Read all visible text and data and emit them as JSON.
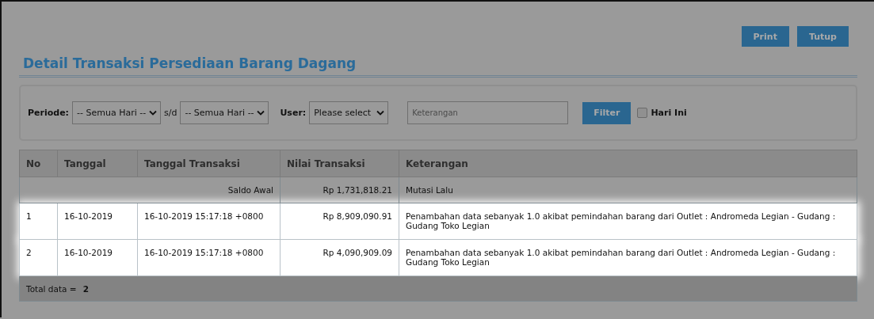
{
  "buttons": [
    {
      "label": "Print"
    },
    {
      "label": "Tutup"
    }
  ],
  "title": "Detail Transaksi Persediaan Barang Dagang",
  "filter": {
    "periode_label": "Periode:",
    "from_value": "-- Semua Hari --",
    "separator": "s/d",
    "to_value": "-- Semua Hari --",
    "user_label": "User:",
    "user_value": "Please select",
    "keterangan_placeholder": "Keterangan",
    "filter_button": "Filter",
    "today_checkbox": {
      "label": "Hari Ini",
      "checked": false
    }
  },
  "table": {
    "columns": [
      "No",
      "Tanggal",
      "Tanggal Transaksi",
      "Nilai Transaksi",
      "Keterangan"
    ],
    "opening": {
      "label": "Saldo Awal",
      "value": "Rp 1,731,818.21",
      "note": "Mutasi Lalu",
      "highlighted": false
    },
    "rows": [
      {
        "no": "1",
        "tanggal": "16-10-2019",
        "tanggal_transaksi": "16-10-2019 15:17:18 +0800",
        "nilai": "Rp 8,909,090.91",
        "keterangan": "Penambahan data sebanyak 1.0 akibat pemindahan barang dari Outlet : Andromeda Legian - Gudang : Gudang Toko Legian",
        "highlighted": true
      },
      {
        "no": "2",
        "tanggal": "16-10-2019",
        "tanggal_transaksi": "16-10-2019 15:17:18 +0800",
        "nilai": "Rp 4,090,909.09",
        "keterangan": "Penambahan data sebanyak 1.0 akibat pemindahan barang dari Outlet : Andromeda Legian - Gudang : Gudang Toko Legian",
        "highlighted": true
      }
    ],
    "footer": {
      "label": "Total data =",
      "count": "2"
    }
  }
}
